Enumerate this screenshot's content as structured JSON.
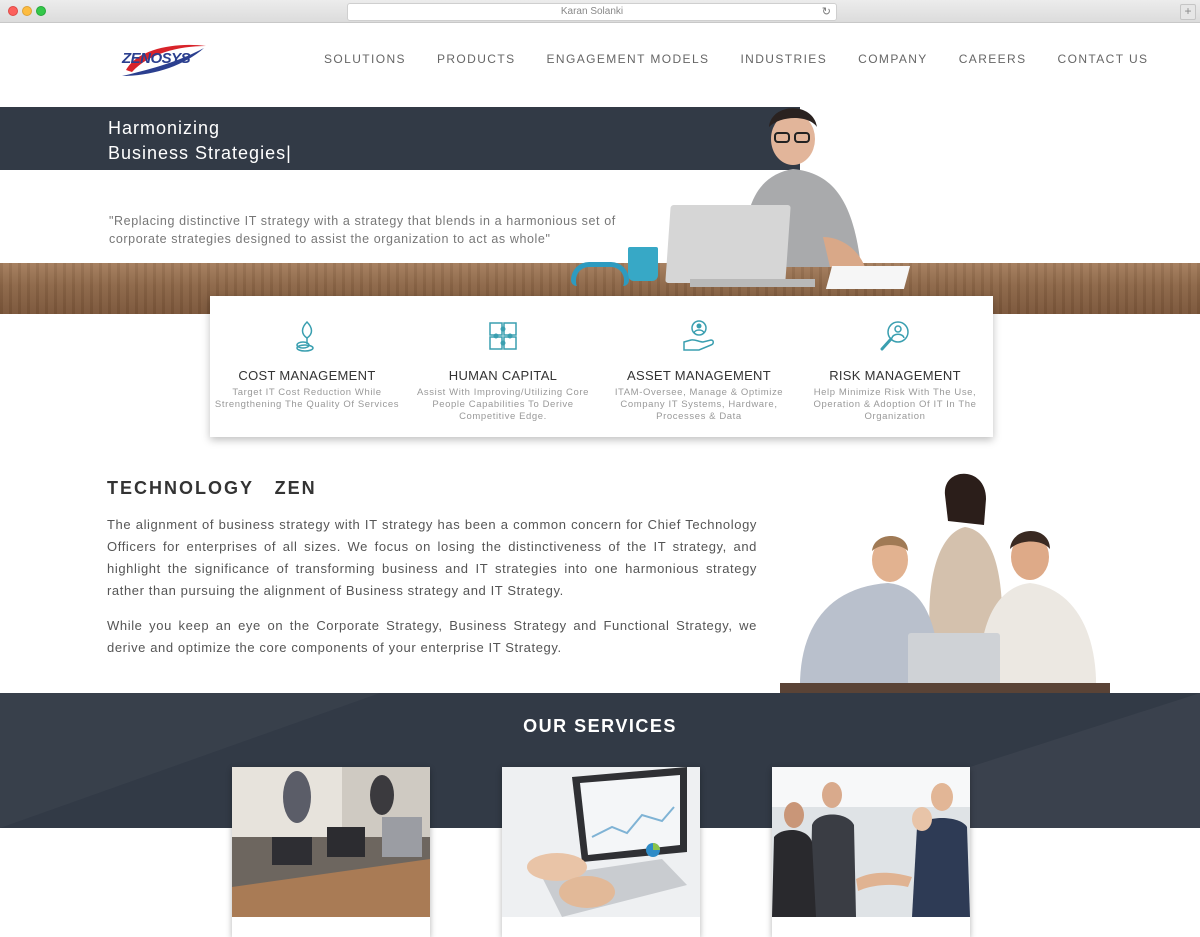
{
  "browser": {
    "url_title": "Karan Solanki",
    "reload_icon": "reload-icon",
    "new_tab_icon": "plus-icon"
  },
  "header": {
    "logo_text": "ZENOSYS",
    "nav": [
      "SOLUTIONS",
      "PRODUCTS",
      "ENGAGEMENT MODELS",
      "INDUSTRIES",
      "COMPANY",
      "CAREERS",
      "CONTACT US"
    ]
  },
  "hero": {
    "title_line1": "Harmonizing",
    "title_line2": "Business Strategies|",
    "quote": "\"Replacing distinctive IT strategy with a strategy that blends in a harmonious set of corporate strategies designed to assist the organization to act as whole\""
  },
  "features": [
    {
      "icon": "plant-coins-icon",
      "title": "COST MANAGEMENT",
      "desc": "Target IT Cost Reduction While Strengthening The Quality Of Services"
    },
    {
      "icon": "puzzle-icon",
      "title": "HUMAN CAPITAL",
      "desc": "Assist With Improving/Utilizing Core People Capabilities To Derive Competitive Edge."
    },
    {
      "icon": "hand-person-icon",
      "title": "ASSET MANAGEMENT",
      "desc": "ITAM-Oversee, Manage & Optimize Company IT Systems, Hardware, Processes & Data"
    },
    {
      "icon": "magnifier-person-icon",
      "title": "RISK MANAGEMENT",
      "desc": "Help Minimize Risk With The Use, Operation & Adoption Of IT In The Organization"
    }
  ],
  "technology_zen": {
    "title": "TECHNOLOGY   ZEN",
    "p1": "The alignment of business strategy with IT strategy has been a common concern for Chief Technology Officers for enterprises of all sizes. We focus on losing the distinctiveness of the IT strategy, and highlight the significance of transforming business and IT strategies into one harmonious strategy rather than pursuing the alignment of Business strategy and IT Strategy.",
    "p2": "While you keep an eye on the Corporate Strategy, Business Strategy and Functional Strategy, we derive and optimize the core components of your enterprise IT Strategy."
  },
  "services": {
    "title": "OUR SERVICES"
  },
  "colors": {
    "dark_band": "#323a46",
    "accent_teal": "#3a9fb0",
    "logo_blue": "#2b3f8f",
    "logo_red": "#d8232a"
  }
}
